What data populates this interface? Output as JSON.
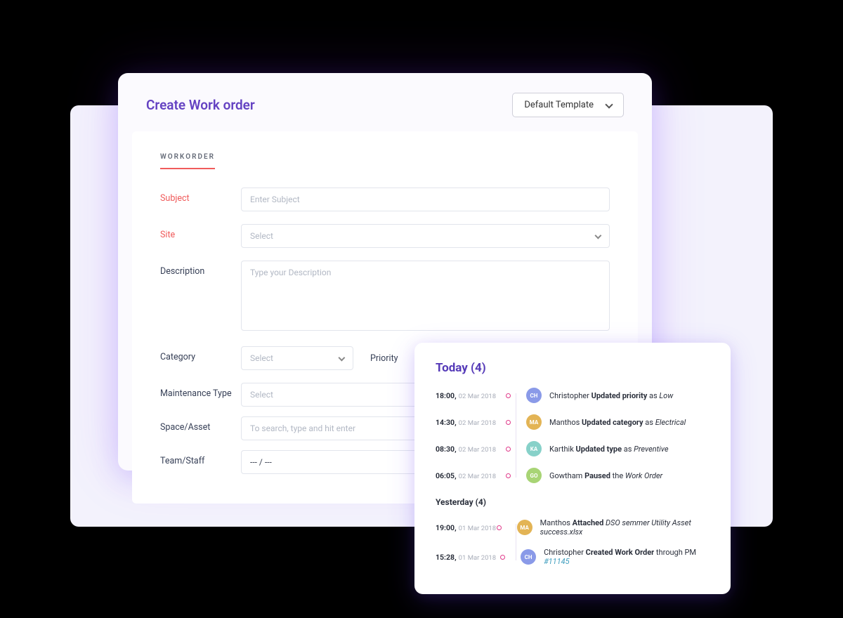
{
  "header": {
    "title": "Create Work order",
    "template_selected": "Default Template"
  },
  "section_label": "WORKORDER",
  "fields": {
    "subject": {
      "label": "Subject",
      "placeholder": "Enter Subject"
    },
    "site": {
      "label": "Site",
      "placeholder": "Select"
    },
    "description": {
      "label": "Description",
      "placeholder": "Type your Description"
    },
    "category": {
      "label": "Category",
      "placeholder": "Select"
    },
    "priority": {
      "label": "Priority"
    },
    "maint": {
      "label": "Maintenance Type",
      "placeholder": "Select"
    },
    "space": {
      "label": "Space/Asset",
      "placeholder": "To search, type and hit enter"
    },
    "team": {
      "label": "Team/Staff",
      "value": "--- / ---"
    }
  },
  "activity": {
    "today_header": "Today (4)",
    "today": [
      {
        "time": "18:00",
        "date": "02 Mar 2018",
        "av": "CH",
        "avcls": "av-ch",
        "who": "Christopher",
        "act": "Updated priority",
        "mid": "as",
        "obj": "Low"
      },
      {
        "time": "14:30",
        "date": "02 Mar 2018",
        "av": "MA",
        "avcls": "av-ma",
        "who": "Manthos",
        "act": "Updated category",
        "mid": "as",
        "obj": "Electrical"
      },
      {
        "time": "08:30",
        "date": "02 Mar 2018",
        "av": "KA",
        "avcls": "av-ka",
        "who": "Karthik",
        "act": "Updated type",
        "mid": "as",
        "obj": "Preventive"
      },
      {
        "time": "06:05",
        "date": "02 Mar 2018",
        "av": "GO",
        "avcls": "av-go",
        "who": "Gowtham",
        "act": "Paused",
        "mid": "the",
        "obj": "Work Order"
      }
    ],
    "yest_header": "Yesterday (4)",
    "yesterday": [
      {
        "time": "19:00",
        "date": "01 Mar 2018",
        "av": "MA",
        "avcls": "av-ma",
        "who": "Manthos",
        "act": "Attached",
        "obj": "DSO semmer Utility Asset success.xlsx"
      },
      {
        "time": "15:28",
        "date": "01 Mar 2018",
        "av": "CH",
        "avcls": "av-ch",
        "who": "Christopher",
        "act": "Created Work Order",
        "mid": "through PM",
        "link": "#11145"
      }
    ]
  }
}
